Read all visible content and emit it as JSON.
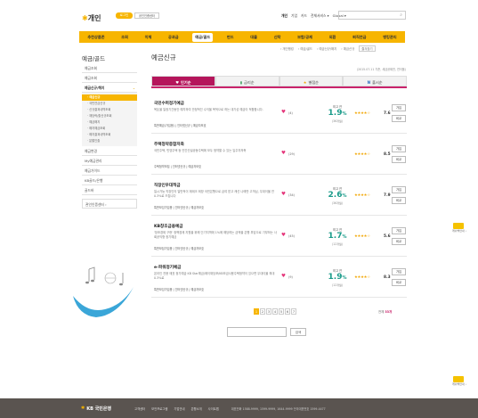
{
  "header": {
    "brand": "개인",
    "login": "로그인",
    "cert": "공인인증센터",
    "nav": [
      "개인",
      "기업",
      "카드",
      "전체서비스 ▾",
      "Global ▾"
    ],
    "search_icon": "search-icon"
  },
  "mainnav": [
    "추천상품존",
    "조회",
    "이체",
    "공과금",
    "예금/골드",
    "펀드",
    "대출",
    "신탁",
    "보험/공제",
    "외환",
    "퇴직연금",
    "뱅킹관리"
  ],
  "crumb": [
    "› 개인뱅킹",
    "› 예금/골드",
    "› 예금신규/해지",
    "› 예금신규"
  ],
  "crumb_btn": "즐겨찾기",
  "side": {
    "title": "예금/골드",
    "items": [
      "예금조회",
      "예금조회",
      "예금신규/해지",
      "예금변경",
      "My예금관리",
      "예금가이드",
      "KB골드/은행",
      "골드바"
    ],
    "subs": [
      "· 예금신규",
      "· 국민연금신규",
      "· 신규결과내역조회",
      "· 재당락/출신규조회",
      "· 예금해지",
      "· 해지예금조회",
      "· 해지결과내역조회",
      "· 분할인출"
    ],
    "extra": "관인인증센터 ›"
  },
  "page": {
    "title": "예금신규",
    "std": "(2015.07.11 기준, 세금공제전, 연이율)",
    "tabs": [
      "인기순",
      "금리순",
      "별점순",
      "출시순"
    ]
  },
  "products": [
    {
      "name": "국민수퍼정기예금",
      "desc": "목돈을 일정기간동안 예치하여 안정적인 수익을 목적으로 하는 대기성 예금이 적합합니다.",
      "links": "특판예금(가입용) | 인터넷신규 | 예금자보호",
      "count": "(4)",
      "lab": "최고 연",
      "rate": "1.9",
      "unit": "%",
      "period": "(36개월)",
      "stars": "★★★★☆",
      "score": "7.6"
    },
    {
      "name": "주택청약종합저축",
      "desc": "국민주택, 민영주택 등 민간건설공동주택에 모두 청약할 수 있는 입주자저축",
      "links": "주택청약모집 | 인터넷신규 | 예금자보호",
      "count": "(29)",
      "lab": "",
      "rate": "",
      "unit": "",
      "period": "",
      "stars": "★★★★☆",
      "score": "8.5"
    },
    {
      "name": "직장인우대적금",
      "desc": "일시가능 직장인의 일반적이 재테크 희망 국민은행으로 급여 받고 캐선 나에만 고객님, 우대이율 연0.3%로 드립니다",
      "links": "특판모임가입용 | 인터넷신규 | 예금자보호",
      "count": "(34)",
      "lab": "최고 연",
      "rate": "2.6",
      "unit": "%",
      "period": "(36개월)",
      "stars": "★★★★☆",
      "score": "7.9"
    },
    {
      "name": "KB창조금융예금",
      "desc": "'창조경제 구현' 정책경제 지원을 위해 인기지역에 1%에 해당하는 금액을 은행 부담으로 기부하는 사회공익형 정기예금",
      "links": "특판모집가입용 | 인터넷신규 | 예금자보호",
      "count": "(45)",
      "lab": "최고 연",
      "rate": "1.7",
      "unit": "%",
      "period": "(12개월)",
      "stars": "★★★★☆",
      "score": "5.6"
    },
    {
      "name": "e-파워정기예금",
      "desc": "온라인 전용 매표 정기예금 KB Star예금/에이재당포/KB모금사용주택청약이 있으면 우대이율 최대 0.3%로",
      "links": "특판모임가입용 | 인터넷신규 | 예금자보호",
      "count": "(9)",
      "lab": "최고 연",
      "rate": "1.9",
      "unit": "%",
      "period": "(12개월)",
      "stars": "★★★★☆",
      "score": "8.3"
    }
  ],
  "btn_join": "가입",
  "btn_compare": "비교",
  "pager": [
    "1",
    "2",
    "3",
    "4",
    "5",
    "6",
    "7"
  ],
  "total_label": "전체",
  "total_count": "33개",
  "bottom_btn": "검색",
  "qr_label": "캐쉬백안내 ›",
  "footer": {
    "logo": "KB 국민은행",
    "links": [
      "고객센터",
      "보안프로그램",
      "기업안내",
      "은행소개",
      "사이트맵"
    ],
    "phone": "대표전화 1588-9999, 1599-9999, 1644-9999 전국대표번호 1599-4477"
  }
}
